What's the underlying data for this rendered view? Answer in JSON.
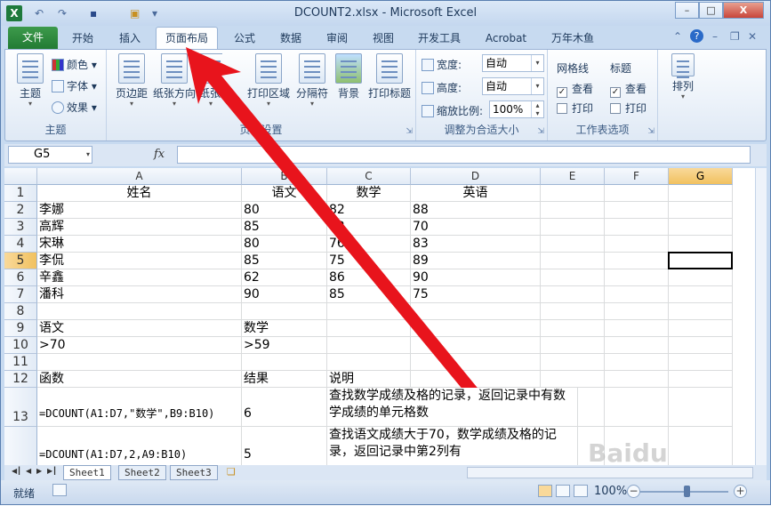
{
  "window": {
    "title": "DCOUNT2.xlsx - Microsoft Excel",
    "logo": "X",
    "controls": {
      "minimize": "–",
      "maximize": "□",
      "close": "X"
    },
    "qat": {
      "undo": "↶",
      "redo": "↷",
      "save": "▪",
      "open": "▣",
      "more": "▾"
    }
  },
  "tabs": [
    {
      "label": "文件"
    },
    {
      "label": "开始"
    },
    {
      "label": "插入"
    },
    {
      "label": "页面布局"
    },
    {
      "label": "公式"
    },
    {
      "label": "数据"
    },
    {
      "label": "审阅"
    },
    {
      "label": "视图"
    },
    {
      "label": "开发工具"
    },
    {
      "label": "Acrobat"
    },
    {
      "label": "万年木鱼"
    }
  ],
  "ribbon": {
    "theme_group": {
      "label": "主题",
      "theme_button": "主题",
      "colors": "颜色",
      "fonts": "字体",
      "effects": "效果"
    },
    "page_setup_group": {
      "label": "页面设置",
      "margins": "页边距",
      "orientation": "纸张方向",
      "size": "纸张大小",
      "print_area": "打印区域",
      "breaks": "分隔符",
      "background": "背景",
      "print_titles": "打印标题"
    },
    "scale_group": {
      "label": "调整为合适大小",
      "width_label": "宽度:",
      "width_value": "自动",
      "height_label": "高度:",
      "height_value": "自动",
      "scale_label": "缩放比例:",
      "scale_value": "100%"
    },
    "sheet_options_group": {
      "label": "工作表选项",
      "gridlines": "网格线",
      "headings": "标题",
      "view": "查看",
      "print": "打印"
    },
    "arrange_group": {
      "label": "排列"
    }
  },
  "formula_bar": {
    "name_box": "G5",
    "fx": "fx",
    "formula": ""
  },
  "columns": [
    "A",
    "B",
    "C",
    "D",
    "E",
    "F",
    "G"
  ],
  "rows": [
    {
      "num": "1",
      "cells": [
        "姓名",
        "语文",
        "数学",
        "英语",
        "",
        "",
        ""
      ]
    },
    {
      "num": "2",
      "cells": [
        "李娜",
        "80",
        "82",
        "88",
        "",
        "",
        ""
      ]
    },
    {
      "num": "3",
      "cells": [
        "高辉",
        "85",
        "72",
        "70",
        "",
        "",
        ""
      ]
    },
    {
      "num": "4",
      "cells": [
        "宋琳",
        "80",
        "76",
        "83",
        "",
        "",
        ""
      ]
    },
    {
      "num": "5",
      "cells": [
        "李侃",
        "85",
        "75",
        "89",
        "",
        "",
        ""
      ]
    },
    {
      "num": "6",
      "cells": [
        "辛鑫",
        "62",
        "86",
        "90",
        "",
        "",
        ""
      ]
    },
    {
      "num": "7",
      "cells": [
        "潘科",
        "90",
        "85",
        "75",
        "",
        "",
        ""
      ]
    },
    {
      "num": "8",
      "cells": [
        "",
        "",
        "",
        "",
        "",
        "",
        ""
      ]
    },
    {
      "num": "9",
      "cells": [
        "语文",
        "数学",
        "",
        "",
        "",
        "",
        ""
      ]
    },
    {
      "num": "10",
      "cells": [
        ">70",
        ">59",
        "",
        "",
        "",
        "",
        ""
      ]
    },
    {
      "num": "11",
      "cells": [
        "",
        "",
        "",
        "",
        "",
        "",
        ""
      ]
    },
    {
      "num": "12",
      "cells": [
        "函数",
        "结果",
        "说明",
        "",
        "",
        "",
        ""
      ]
    },
    {
      "num": "13",
      "cells": [
        "=DCOUNT(A1:D7,\"数学\",B9:B10)",
        "6",
        "查找数学成绩及格的记录，返回记录中有数学成绩的单元格数",
        "",
        "",
        "",
        ""
      ]
    },
    {
      "num": "",
      "cells": [
        "=DCOUNT(A1:D7,2,A9:B10)",
        "5",
        "查找语文成绩大于70，数学成绩及格的记录，返回记录中第2列有",
        "",
        "",
        "",
        ""
      ]
    }
  ],
  "selected_cell": "G5",
  "sheets": [
    "Sheet1",
    "Sheet2",
    "Sheet3"
  ],
  "status": {
    "ready": "就绪",
    "zoom": "100%",
    "zoom_out": "−",
    "zoom_in": "+"
  },
  "watermark": "Baidu"
}
